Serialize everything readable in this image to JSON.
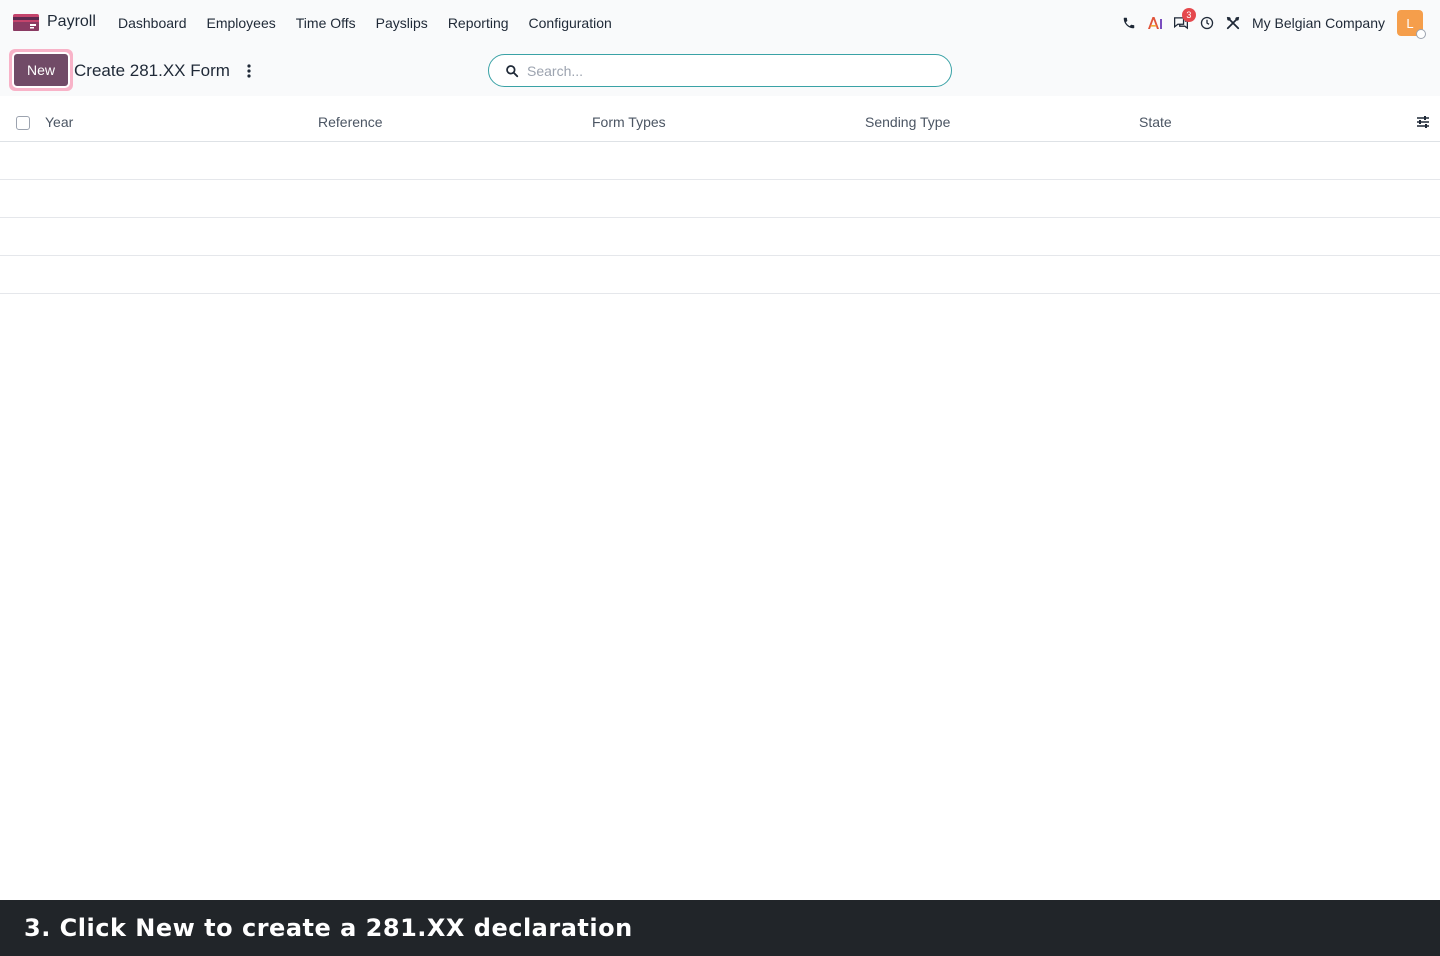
{
  "navbar": {
    "app_name": "Payroll",
    "menu": [
      "Dashboard",
      "Employees",
      "Time Offs",
      "Payslips",
      "Reporting",
      "Configuration"
    ],
    "messages_badge": "3",
    "company": "My Belgian Company",
    "avatar_initial": "L"
  },
  "control": {
    "new_label": "New",
    "title": "Create 281.XX Form",
    "search_placeholder": "Search..."
  },
  "list": {
    "columns": [
      "Year",
      "Reference",
      "Form Types",
      "Sending Type",
      "State"
    ],
    "rows": []
  },
  "caption": "3. Click New to create a 281.XX declaration",
  "colors": {
    "brand": "#714b67",
    "highlight": "#f8b3c8",
    "search_border": "#3aa2a6",
    "badge": "#e5484d",
    "avatar": "#f59e4b"
  }
}
